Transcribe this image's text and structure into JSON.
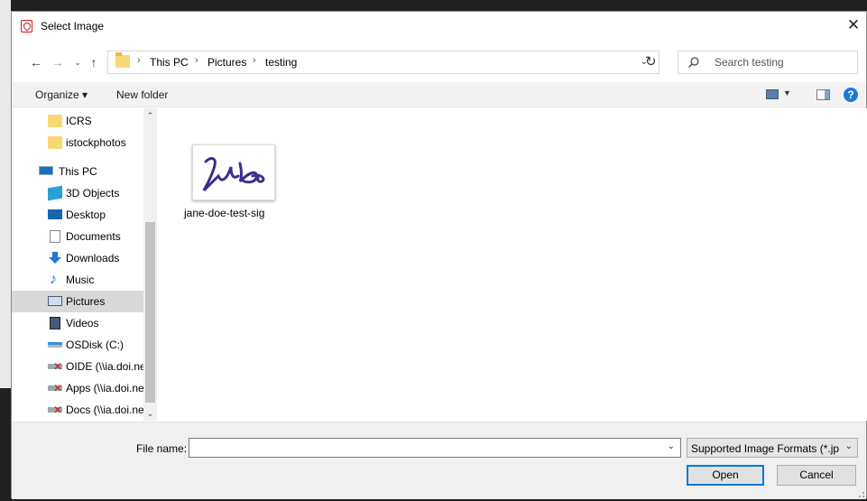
{
  "window": {
    "title": "Select Image",
    "close_glyph": "✕"
  },
  "nav": {
    "back_glyph": "←",
    "forward_glyph": "→",
    "recent_glyph": "⌄",
    "up_glyph": "↑",
    "breadcrumb": [
      "This PC",
      "Pictures",
      "testing"
    ],
    "crumb_sep": "›",
    "address_dropdown_glyph": "⌄",
    "refresh_glyph": "↻",
    "search_placeholder": "Search testing"
  },
  "commands": {
    "organize": "Organize ▾",
    "new_folder": "New folder",
    "view_dropdown_glyph": "▼",
    "help_glyph": "?"
  },
  "sidebar": {
    "items": [
      {
        "label": "ICRS",
        "icon": "folder-icon"
      },
      {
        "label": "istockphotos",
        "icon": "folder-icon"
      },
      {
        "label": "This PC",
        "icon": "computer-icon"
      },
      {
        "label": "3D Objects",
        "icon": "3d-objects-icon"
      },
      {
        "label": "Desktop",
        "icon": "desktop-icon"
      },
      {
        "label": "Documents",
        "icon": "documents-icon"
      },
      {
        "label": "Downloads",
        "icon": "downloads-icon"
      },
      {
        "label": "Music",
        "icon": "music-icon"
      },
      {
        "label": "Pictures",
        "icon": "pictures-icon",
        "selected": true
      },
      {
        "label": "Videos",
        "icon": "videos-icon"
      },
      {
        "label": "OSDisk (C:)",
        "icon": "drive-icon"
      },
      {
        "label": "OIDE (\\\\ia.doi.ne",
        "icon": "disconnected-drive-icon"
      },
      {
        "label": "Apps (\\\\ia.doi.ne",
        "icon": "disconnected-drive-icon"
      },
      {
        "label": "Docs (\\\\ia.doi.ne",
        "icon": "disconnected-drive-icon"
      }
    ],
    "scroll_up_glyph": "⌃",
    "scroll_down_glyph": "⌄"
  },
  "files": [
    {
      "name": "jane-doe-test-sig",
      "type": "image"
    }
  ],
  "footer": {
    "file_name_label": "File name:",
    "file_name_value": "",
    "file_name_dropdown_glyph": "⌄",
    "filter_label": "Supported Image Formats (*.jpg",
    "filter_dropdown_glyph": "⌄",
    "open_label": "Open",
    "cancel_label": "Cancel"
  },
  "colors": {
    "accent": "#0078d7",
    "selection": "#d9d9d9",
    "signature_ink": "#3a2f8a"
  }
}
